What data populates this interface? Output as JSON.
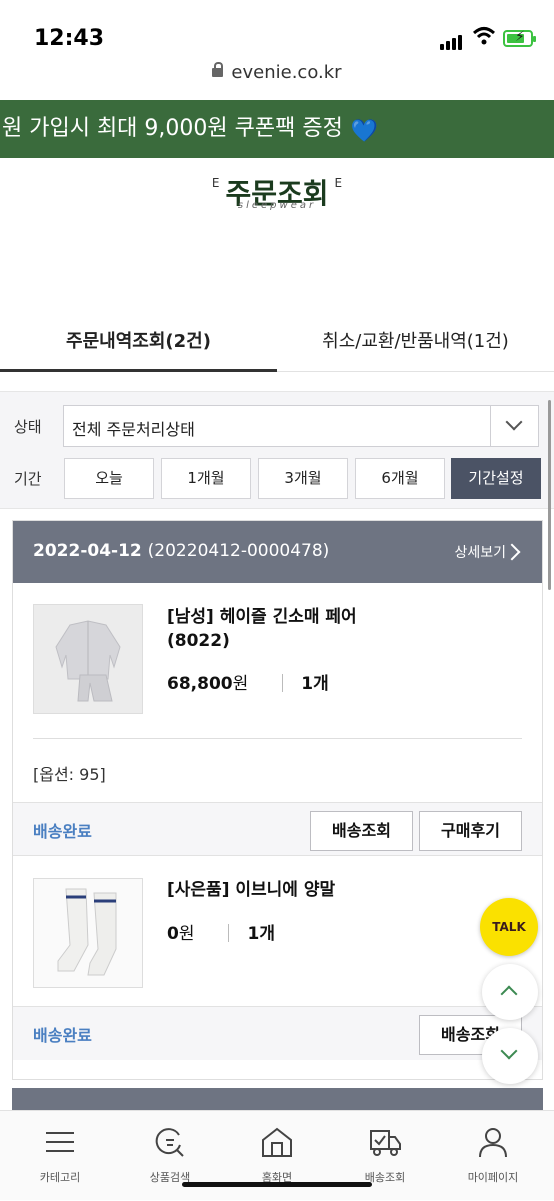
{
  "status_bar": {
    "time": "12:43"
  },
  "browser": {
    "url": "evenie.co.kr"
  },
  "banner": {
    "text": "원 가입시 최대 9,000원 쿠폰팩 증정",
    "heart": "💙"
  },
  "logo": {
    "title": "주문조회",
    "letter": "E",
    "sub": "sleepwear"
  },
  "tabs": [
    {
      "label": "주문내역조회(2건)"
    },
    {
      "label": "취소/교환/반품내역(1건)"
    }
  ],
  "filter": {
    "status_label": "상태",
    "status_value": "전체 주문처리상태",
    "period_label": "기간",
    "periods": [
      {
        "label": "오늘"
      },
      {
        "label": "1개월"
      },
      {
        "label": "3개월"
      },
      {
        "label": "6개월"
      },
      {
        "label": "기간설정"
      }
    ]
  },
  "order": {
    "date": "2022-04-12",
    "order_no": "(20220412-0000478)",
    "detail_label": "상세보기",
    "items": [
      {
        "name_line1": "[남성] 헤이즐 긴소매 페어",
        "name_line2": "(8022)",
        "price": "68,800",
        "won": "원",
        "qty": "1개",
        "option": "[옵션: 95]",
        "status": "배송완료",
        "btn_track": "배송조회",
        "btn_review": "구매후기"
      },
      {
        "name_line1": "[사은품] 이브니에 양말",
        "price": "0",
        "won": "원",
        "qty": "1개",
        "status": "배송완료",
        "btn_track": "배송조회"
      }
    ]
  },
  "floating": {
    "talk": "TALK"
  },
  "bottom_nav": [
    {
      "label": "카테고리",
      "icon": "menu-icon"
    },
    {
      "label": "상품검색",
      "icon": "search-icon"
    },
    {
      "label": "홈화면",
      "icon": "home-icon"
    },
    {
      "label": "배송조회",
      "icon": "delivery-truck-icon"
    },
    {
      "label": "마이페이지",
      "icon": "user-icon"
    }
  ],
  "colors": {
    "banner_bg": "#3a6b3c",
    "card_header": "#6e7482",
    "status_blue": "#4a7fc1",
    "active_period": "#4b5365",
    "kakao_yellow": "#fae100"
  }
}
